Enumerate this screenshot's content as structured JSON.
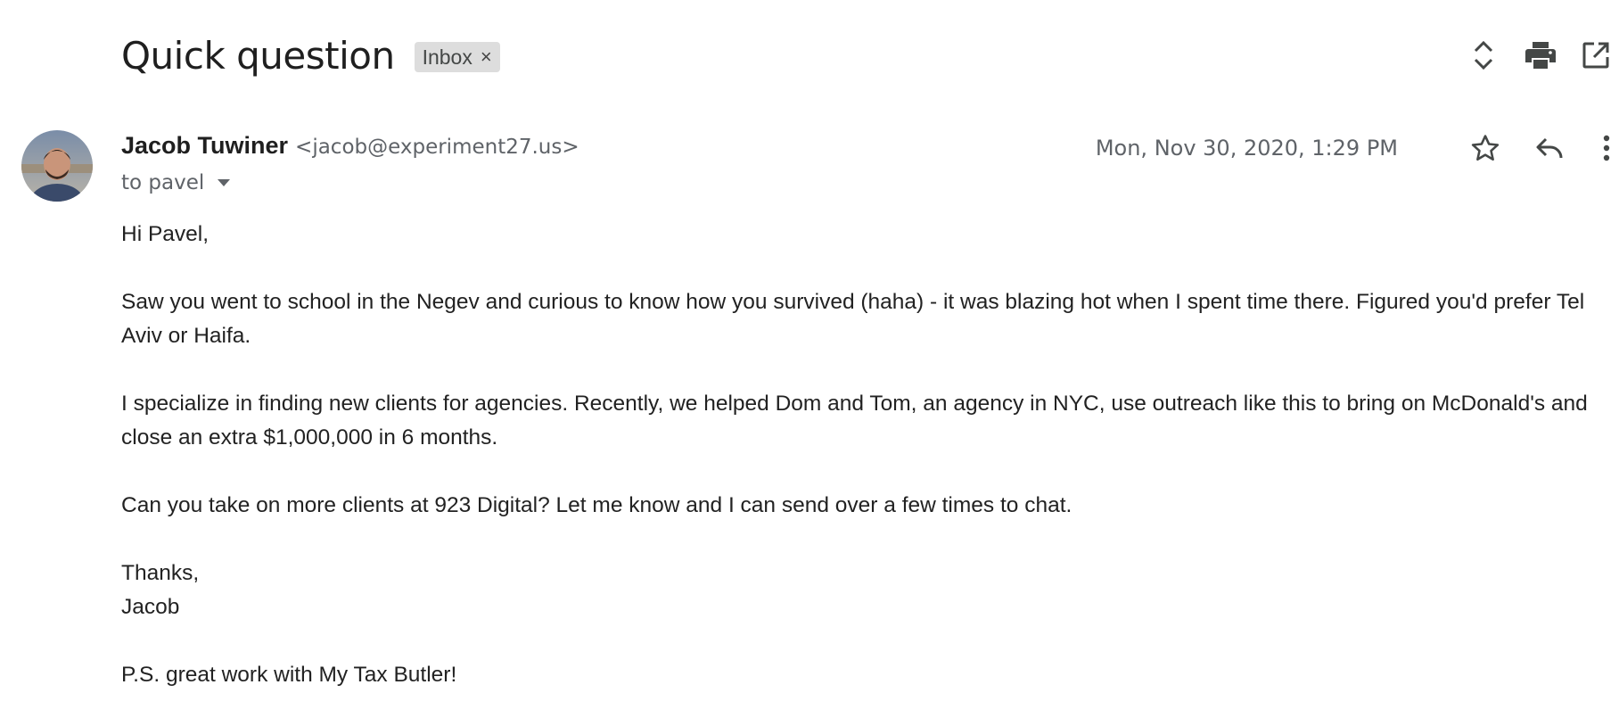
{
  "email": {
    "subject": "Quick question",
    "label": "Inbox",
    "label_remove": "×",
    "sender": {
      "name": "Jacob Tuwiner",
      "email": "<jacob@experiment27.us>"
    },
    "recipient": "to pavel",
    "date": "Mon, Nov 30, 2020, 1:29 PM",
    "body": {
      "greeting": "Hi Pavel,",
      "paragraph1": "Saw you went to school in the Negev and curious to know how you survived (haha) - it was blazing hot when I spent time there. Figured you'd prefer Tel Aviv or Haifa.",
      "paragraph2": "I specialize in finding new clients for agencies. Recently, we helped Dom and Tom, an agency in NYC, use outreach like this to bring on McDonald's and close an extra $1,000,000 in 6 months.",
      "paragraph3": "Can you take on more clients at 923 Digital? Let me know and I can send over a few times to chat.",
      "signoff": "Thanks,",
      "signature": "Jacob",
      "postscript": "P.S. great work with My Tax Butler!"
    }
  },
  "icons": {
    "expand": "expand-collapse-icon",
    "print": "print-icon",
    "open_new_window": "open-in-new-window-icon",
    "star": "star-icon",
    "reply": "reply-icon",
    "more": "more-vertical-icon",
    "dropdown": "caret-down-icon"
  },
  "colors": {
    "text": "#202124",
    "muted": "#5f6368",
    "chip_bg": "#dddddd",
    "icon": "#444746"
  }
}
